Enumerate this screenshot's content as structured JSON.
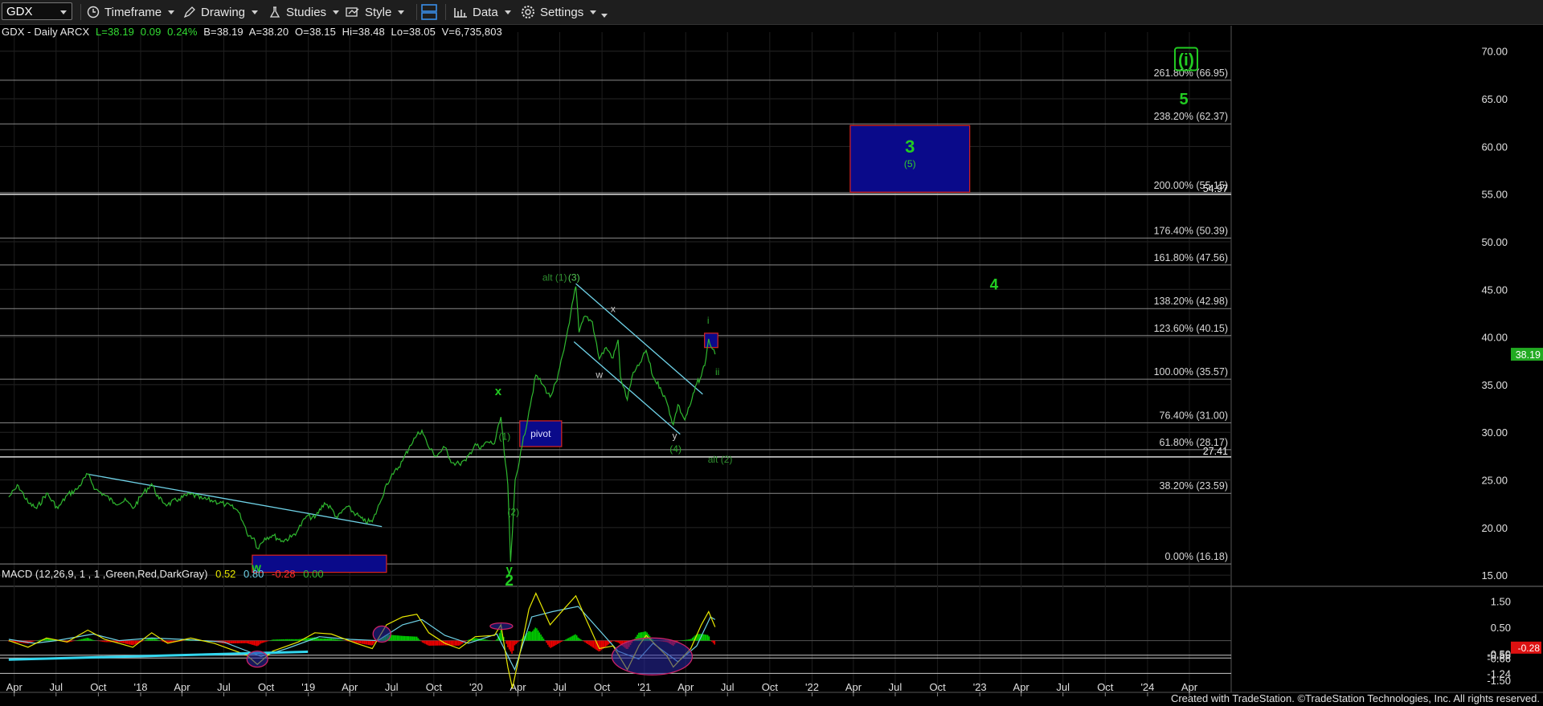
{
  "toolbar": {
    "symbol": "GDX",
    "timeframe_label": "Timeframe",
    "drawing_label": "Drawing",
    "studies_label": "Studies",
    "style_label": "Style",
    "data_label": "Data",
    "settings_label": "Settings"
  },
  "info": {
    "title": "GDX - Daily  ARCX",
    "last": "L=38.19",
    "change": "0.09",
    "change_pct": "0.24%",
    "bid": "B=38.19",
    "ask": "A=38.20",
    "open": "O=38.15",
    "high": "Hi=38.48",
    "low": "Lo=38.05",
    "volume": "V=6,735,803"
  },
  "macd_info": {
    "label": "MACD (12,26,9, 1 , 1 ,Green,Red,DarkGray)",
    "macd": "0.52",
    "signal": "0.80",
    "diff": "-0.28",
    "zero": "0.00"
  },
  "footer": "Created with TradeStation. ©TradeStation Technologies, Inc. All rights reserved.",
  "colors": {
    "background": "#000000",
    "price": "#2fb82f",
    "up_label": "#22cc22",
    "box_fill": "#0a0a8a",
    "box_border": "#cc2222",
    "trendline": "#6fd3e8",
    "fib_line": "#d8d8d8",
    "macd_pos": "#00cc00",
    "macd_neg": "#ee0000"
  },
  "chart_data": {
    "type": "line",
    "ylim": [
      14,
      72
    ],
    "y_ticks": [
      "70.00",
      "65.00",
      "60.00",
      "55.00",
      "50.00",
      "45.00",
      "40.00",
      "35.00",
      "30.00",
      "25.00",
      "20.00",
      "15.00"
    ],
    "x_ticks": [
      "Apr",
      "Jul",
      "Oct",
      "'18",
      "Apr",
      "Jul",
      "Oct",
      "'19",
      "Apr",
      "Jul",
      "Oct",
      "'20",
      "Apr",
      "Jul",
      "Oct",
      "'21",
      "Apr",
      "Jul",
      "Oct",
      "'22",
      "Apr",
      "Jul",
      "Oct",
      "'23",
      "Apr",
      "Jul",
      "Oct",
      "'24",
      "Apr"
    ],
    "last_price": "38.19",
    "fib_levels": [
      {
        "label": "261.80% (66.95)",
        "value": 66.95
      },
      {
        "label": "238.20% (62.37)",
        "value": 62.37
      },
      {
        "label": "200.00% (55.15)",
        "value": 55.15
      },
      {
        "label": "176.40% (50.39)",
        "value": 50.39
      },
      {
        "label": "161.80% (47.56)",
        "value": 47.56
      },
      {
        "label": "138.20% (42.98)",
        "value": 42.98
      },
      {
        "label": "123.60% (40.15)",
        "value": 40.15
      },
      {
        "label": "100.00% (35.57)",
        "value": 35.57
      },
      {
        "label": "76.40% (31.00)",
        "value": 31.0
      },
      {
        "label": "61.80% (28.17)",
        "value": 28.17
      },
      {
        "label": "38.20% (23.59)",
        "value": 23.59
      },
      {
        "label": "0.00% (16.18)",
        "value": 16.18
      }
    ],
    "hlines": [
      {
        "label": "54.97",
        "value": 54.97
      },
      {
        "label": "27.41",
        "value": 27.41
      }
    ],
    "price_series": [
      [
        "2017-03-20",
        23.2
      ],
      [
        "2017-04-10",
        24.4
      ],
      [
        "2017-05-01",
        22.6
      ],
      [
        "2017-05-20",
        22.0
      ],
      [
        "2017-06-10",
        23.6
      ],
      [
        "2017-07-05",
        22.0
      ],
      [
        "2017-07-25",
        23.4
      ],
      [
        "2017-08-15",
        24.0
      ],
      [
        "2017-09-08",
        25.6
      ],
      [
        "2017-09-25",
        24.0
      ],
      [
        "2017-10-15",
        23.4
      ],
      [
        "2017-11-05",
        22.6
      ],
      [
        "2017-12-01",
        22.8
      ],
      [
        "2017-12-15",
        22.0
      ],
      [
        "2018-01-05",
        23.5
      ],
      [
        "2018-01-25",
        24.6
      ],
      [
        "2018-02-10",
        23.0
      ],
      [
        "2018-03-01",
        22.4
      ],
      [
        "2018-03-25",
        23.0
      ],
      [
        "2018-04-20",
        23.5
      ],
      [
        "2018-05-15",
        23.0
      ],
      [
        "2018-06-10",
        22.8
      ],
      [
        "2018-07-05",
        22.4
      ],
      [
        "2018-07-25",
        22.0
      ],
      [
        "2018-08-05",
        21.5
      ],
      [
        "2018-08-20",
        19.4
      ],
      [
        "2018-09-05",
        18.9
      ],
      [
        "2018-09-12",
        17.8
      ],
      [
        "2018-09-28",
        18.9
      ],
      [
        "2018-10-15",
        19.2
      ],
      [
        "2018-11-05",
        18.6
      ],
      [
        "2018-11-25",
        19.0
      ],
      [
        "2018-12-10",
        19.8
      ],
      [
        "2018-12-28",
        21.2
      ],
      [
        "2019-01-15",
        21.0
      ],
      [
        "2019-02-05",
        22.6
      ],
      [
        "2019-02-20",
        22.0
      ],
      [
        "2019-03-05",
        21.0
      ],
      [
        "2019-03-25",
        22.2
      ],
      [
        "2019-04-15",
        21.4
      ],
      [
        "2019-05-01",
        20.7
      ],
      [
        "2019-05-20",
        20.6
      ],
      [
        "2019-06-05",
        22.5
      ],
      [
        "2019-06-20",
        24.6
      ],
      [
        "2019-07-05",
        25.6
      ],
      [
        "2019-07-25",
        27.0
      ],
      [
        "2019-08-10",
        28.6
      ],
      [
        "2019-08-25",
        29.7
      ],
      [
        "2019-09-05",
        30.2
      ],
      [
        "2019-09-20",
        28.4
      ],
      [
        "2019-10-05",
        27.5
      ],
      [
        "2019-10-25",
        28.4
      ],
      [
        "2019-11-10",
        26.8
      ],
      [
        "2019-11-25",
        26.7
      ],
      [
        "2019-12-10",
        27.0
      ],
      [
        "2019-12-30",
        28.8
      ],
      [
        "2020-01-10",
        28.2
      ],
      [
        "2020-01-25",
        29.0
      ],
      [
        "2020-02-10",
        28.8
      ],
      [
        "2020-02-24",
        31.6
      ],
      [
        "2020-03-02",
        28.0
      ],
      [
        "2020-03-10",
        24.5
      ],
      [
        "2020-03-16",
        16.4
      ],
      [
        "2020-03-20",
        19.5
      ],
      [
        "2020-03-26",
        25.0
      ],
      [
        "2020-04-10",
        28.5
      ],
      [
        "2020-04-25",
        32.2
      ],
      [
        "2020-05-10",
        36.0
      ],
      [
        "2020-05-25",
        35.0
      ],
      [
        "2020-06-10",
        33.7
      ],
      [
        "2020-06-25",
        35.4
      ],
      [
        "2020-07-10",
        38.6
      ],
      [
        "2020-07-25",
        42.5
      ],
      [
        "2020-08-05",
        45.3
      ],
      [
        "2020-08-12",
        40.5
      ],
      [
        "2020-08-25",
        42.2
      ],
      [
        "2020-09-10",
        41.6
      ],
      [
        "2020-09-25",
        37.7
      ],
      [
        "2020-10-10",
        38.9
      ],
      [
        "2020-10-25",
        37.8
      ],
      [
        "2020-11-05",
        39.7
      ],
      [
        "2020-11-10",
        35.9
      ],
      [
        "2020-11-25",
        33.4
      ],
      [
        "2020-12-05",
        35.8
      ],
      [
        "2020-12-20",
        37.0
      ],
      [
        "2021-01-05",
        38.6
      ],
      [
        "2021-01-20",
        35.8
      ],
      [
        "2021-02-05",
        34.7
      ],
      [
        "2021-02-20",
        33.0
      ],
      [
        "2021-03-05",
        30.8
      ],
      [
        "2021-03-15",
        32.9
      ],
      [
        "2021-03-30",
        31.3
      ],
      [
        "2021-04-12",
        33.0
      ],
      [
        "2021-04-25",
        35.1
      ],
      [
        "2021-05-05",
        35.9
      ],
      [
        "2021-05-15",
        37.7
      ],
      [
        "2021-05-21",
        39.8
      ],
      [
        "2021-05-27",
        38.9
      ],
      [
        "2021-06-01",
        38.7
      ],
      [
        "2021-06-04",
        38.19
      ]
    ],
    "trendlines": [
      {
        "name": "upper-2018",
        "from": [
          "2017-09-08",
          25.6
        ],
        "to": [
          "2019-06-10",
          20.1
        ]
      },
      {
        "name": "channel-top",
        "from": [
          "2020-08-05",
          45.6
        ],
        "to": [
          "2021-05-08",
          34.0
        ]
      },
      {
        "name": "channel-bottom",
        "from": [
          "2020-08-01",
          39.5
        ],
        "to": [
          "2021-03-20",
          29.8
        ]
      }
    ],
    "boxes": [
      {
        "name": "w-target",
        "x0": "2018-09-01",
        "x1": "2019-06-20",
        "y0": 15.3,
        "y1": 17.1,
        "label": ""
      },
      {
        "name": "pivot",
        "x0": "2020-04-05",
        "x1": "2020-07-05",
        "y0": 28.5,
        "y1": 31.2,
        "label": "pivot"
      },
      {
        "name": "wave3-target",
        "x0": "2022-03-25",
        "x1": "2022-12-10",
        "y0": 55.2,
        "y1": 62.2,
        "label": "3",
        "sublabel": "(5)"
      },
      {
        "name": "current",
        "x0": "2021-05-12",
        "x1": "2021-06-10",
        "y0": 38.9,
        "y1": 40.4,
        "label": ""
      }
    ],
    "wave_labels": [
      {
        "text": "w",
        "date": "2018-09-10",
        "price": 15.4,
        "size": 15,
        "color": "#22cc22",
        "bold": true
      },
      {
        "text": "y",
        "date": "2020-03-13",
        "price": 15.2,
        "size": 15,
        "color": "#22cc22",
        "bold": true
      },
      {
        "text": "2",
        "date": "2020-03-13",
        "price": 13.9,
        "size": 19,
        "color": "#22cc22",
        "bold": true
      },
      {
        "text": "x",
        "date": "2020-02-18",
        "price": 33.9,
        "size": 15,
        "color": "#22cc22",
        "bold": true
      },
      {
        "text": "(1)",
        "date": "2020-03-03",
        "price": 29.2,
        "size": 12,
        "color": "#2fa82f",
        "bold": false
      },
      {
        "text": "(2)",
        "date": "2020-03-22",
        "price": 21.3,
        "size": 12,
        "color": "#2fa82f",
        "bold": false
      },
      {
        "text": "alt (1)",
        "date": "2020-06-20",
        "price": 45.9,
        "size": 12,
        "color": "#2f8f2f",
        "bold": false
      },
      {
        "text": "(3)",
        "date": "2020-08-01",
        "price": 45.9,
        "size": 12,
        "color": "#55cc55",
        "bold": false
      },
      {
        "text": "x",
        "date": "2020-10-25",
        "price": 42.6,
        "size": 12,
        "color": "#cccccc",
        "bold": false
      },
      {
        "text": "w",
        "date": "2020-09-25",
        "price": 35.7,
        "size": 12,
        "color": "#cccccc",
        "bold": false
      },
      {
        "text": "y",
        "date": "2021-03-08",
        "price": 29.3,
        "size": 12,
        "color": "#cccccc",
        "bold": false
      },
      {
        "text": "(4)",
        "date": "2021-03-10",
        "price": 27.9,
        "size": 12,
        "color": "#2fa82f",
        "bold": false
      },
      {
        "text": "alt (2)",
        "date": "2021-06-15",
        "price": 26.8,
        "size": 12,
        "color": "#2f8f2f",
        "bold": false
      },
      {
        "text": "i",
        "date": "2021-05-20",
        "price": 41.4,
        "size": 12,
        "color": "#2fa82f",
        "bold": false
      },
      {
        "text": "ii",
        "date": "2021-06-09",
        "price": 36.0,
        "size": 12,
        "color": "#2fa82f",
        "bold": false
      },
      {
        "text": "4",
        "date": "2023-02-01",
        "price": 45.0,
        "size": 19,
        "color": "#22cc22",
        "bold": true
      },
      {
        "text": "5",
        "date": "2024-03-20",
        "price": 64.4,
        "size": 20,
        "color": "#22cc22",
        "bold": true
      },
      {
        "text": "(i)",
        "date": "2024-03-25",
        "price": 68.5,
        "size": 21,
        "color": "#22cc22",
        "bold": true
      }
    ],
    "macd": {
      "ylim": [
        -1.9,
        2.0
      ],
      "y_ticks": [
        {
          "label": "1.50",
          "value": 1.5
        },
        {
          "label": "0.50",
          "value": 0.5
        },
        {
          "label": "-0.50",
          "value": -0.5
        },
        {
          "label": "-1.50",
          "value": -1.5
        },
        {
          "label": "-1.24",
          "value": -1.24
        },
        {
          "label": "-0.55",
          "value": -0.55
        },
        {
          "label": "-0.66",
          "value": -0.66
        },
        {
          "label": "-0.28",
          "value": -0.28
        }
      ],
      "hlines": [
        -0.55,
        -0.66,
        -1.24
      ],
      "macd_series": [
        [
          "2017-03-20",
          0.0
        ],
        [
          "2017-05-01",
          -0.25
        ],
        [
          "2017-06-10",
          0.1
        ],
        [
          "2017-07-25",
          -0.05
        ],
        [
          "2017-09-08",
          0.4
        ],
        [
          "2017-10-15",
          0.05
        ],
        [
          "2017-12-15",
          -0.25
        ],
        [
          "2018-01-25",
          0.3
        ],
        [
          "2018-03-01",
          -0.1
        ],
        [
          "2018-04-20",
          0.1
        ],
        [
          "2018-06-10",
          -0.1
        ],
        [
          "2018-08-20",
          -0.55
        ],
        [
          "2018-09-12",
          -0.9
        ],
        [
          "2018-10-15",
          -0.4
        ],
        [
          "2018-12-10",
          -0.05
        ],
        [
          "2019-01-15",
          0.3
        ],
        [
          "2019-02-20",
          0.25
        ],
        [
          "2019-04-15",
          -0.1
        ],
        [
          "2019-05-20",
          -0.3
        ],
        [
          "2019-06-20",
          0.6
        ],
        [
          "2019-07-25",
          0.9
        ],
        [
          "2019-08-25",
          1.0
        ],
        [
          "2019-09-20",
          0.3
        ],
        [
          "2019-10-25",
          -0.1
        ],
        [
          "2019-11-25",
          -0.3
        ],
        [
          "2019-12-30",
          0.15
        ],
        [
          "2020-02-10",
          0.2
        ],
        [
          "2020-02-24",
          0.6
        ],
        [
          "2020-03-10",
          -1.0
        ],
        [
          "2020-03-20",
          -1.8
        ],
        [
          "2020-04-10",
          -0.1
        ],
        [
          "2020-04-25",
          1.2
        ],
        [
          "2020-05-10",
          1.8
        ],
        [
          "2020-06-10",
          0.6
        ],
        [
          "2020-07-10",
          1.2
        ],
        [
          "2020-08-05",
          1.7
        ],
        [
          "2020-08-25",
          0.9
        ],
        [
          "2020-09-25",
          -0.3
        ],
        [
          "2020-10-25",
          -0.2
        ],
        [
          "2020-11-25",
          -1.1
        ],
        [
          "2020-12-20",
          -0.2
        ],
        [
          "2021-01-05",
          0.2
        ],
        [
          "2021-02-20",
          -0.6
        ],
        [
          "2021-03-05",
          -1.0
        ],
        [
          "2021-04-12",
          -0.3
        ],
        [
          "2021-05-05",
          0.6
        ],
        [
          "2021-05-21",
          1.1
        ],
        [
          "2021-06-04",
          0.52
        ]
      ],
      "signal_series": [
        [
          "2017-03-20",
          0.05
        ],
        [
          "2017-05-15",
          -0.1
        ],
        [
          "2017-07-01",
          0.0
        ],
        [
          "2017-09-20",
          0.25
        ],
        [
          "2017-11-15",
          0.0
        ],
        [
          "2018-01-25",
          0.1
        ],
        [
          "2018-04-01",
          0.05
        ],
        [
          "2018-07-01",
          -0.05
        ],
        [
          "2018-09-20",
          -0.6
        ],
        [
          "2018-11-15",
          -0.3
        ],
        [
          "2019-01-25",
          0.15
        ],
        [
          "2019-04-01",
          0.05
        ],
        [
          "2019-06-01",
          0.0
        ],
        [
          "2019-07-25",
          0.6
        ],
        [
          "2019-09-05",
          0.8
        ],
        [
          "2019-10-25",
          0.2
        ],
        [
          "2019-12-15",
          -0.1
        ],
        [
          "2020-02-15",
          0.25
        ],
        [
          "2020-03-25",
          -1.1
        ],
        [
          "2020-05-01",
          0.9
        ],
        [
          "2020-06-15",
          1.1
        ],
        [
          "2020-08-10",
          1.3
        ],
        [
          "2020-09-25",
          0.4
        ],
        [
          "2020-11-05",
          -0.4
        ],
        [
          "2020-12-20",
          -0.7
        ],
        [
          "2021-01-20",
          -0.1
        ],
        [
          "2021-03-15",
          -0.8
        ],
        [
          "2021-04-25",
          -0.2
        ],
        [
          "2021-05-25",
          0.9
        ],
        [
          "2021-06-04",
          0.8
        ]
      ],
      "trendline": {
        "from": [
          "2017-03-20",
          -0.72
        ],
        "to": [
          "2018-12-31",
          -0.42
        ]
      },
      "ellipses": [
        {
          "date": "2018-09-12",
          "value": -0.7,
          "rx": 13,
          "ry": 10
        },
        {
          "date": "2019-06-10",
          "value": 0.25,
          "rx": 11,
          "ry": 10
        },
        {
          "date": "2020-02-25",
          "value": 0.55,
          "rx": 14,
          "ry": 4
        },
        {
          "date": "2021-01-18",
          "value": -0.6,
          "rx": 50,
          "ry": 23
        }
      ]
    }
  }
}
